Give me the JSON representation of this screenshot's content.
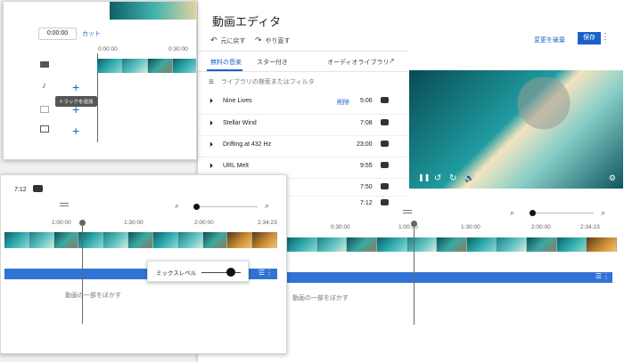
{
  "colors": {
    "accent": "#1a62c9",
    "track_blue": "#3173d5",
    "save_bg": "#1a62c9"
  },
  "top_left": {
    "time": "0:00:00",
    "cut_label": "カット",
    "ruler": [
      "0:00:00",
      "0:30:00"
    ],
    "tooltip": "トラックを追加",
    "track_icons": [
      "video-icon",
      "music-note-icon",
      "subtitles-icon",
      "picture-in-picture-icon"
    ]
  },
  "editor": {
    "title": "動画エディタ",
    "undo": "元に戻す",
    "redo": "やり直す",
    "discard": "変更を破棄",
    "save": "保存",
    "tabs": [
      "無料の音楽",
      "スター付き",
      "オーディオライブラリ"
    ],
    "search_placeholder": "ライブラリの検索またはフィルタ",
    "tracks": [
      {
        "name": "Nine Lives",
        "action": "削除",
        "duration": "5:06"
      },
      {
        "name": "Stellar Wind",
        "action": "",
        "duration": "7:08"
      },
      {
        "name": "Drifting at 432 Hz",
        "action": "",
        "duration": "23:00"
      },
      {
        "name": "URL Melt",
        "action": "",
        "duration": "9:55"
      },
      {
        "name": "",
        "action": "",
        "duration": "7:50"
      },
      {
        "name": "",
        "action": "",
        "duration": "7:12"
      }
    ],
    "ruler": [
      "0:30:00",
      "1:00:00",
      "1:30:00",
      "2:00:00",
      "2:34:23"
    ],
    "blur_label": "動画の一部をぼかす"
  },
  "bottom_left": {
    "duration": "7:12",
    "ruler": [
      "1:00:00",
      "1:30:00",
      "2:00:00",
      "2:34:23"
    ],
    "mix_label": "ミックスレベル",
    "mix_level": 0.6,
    "blur_label": "動画の一部をぼかす",
    "zoom_level": 0.15
  }
}
